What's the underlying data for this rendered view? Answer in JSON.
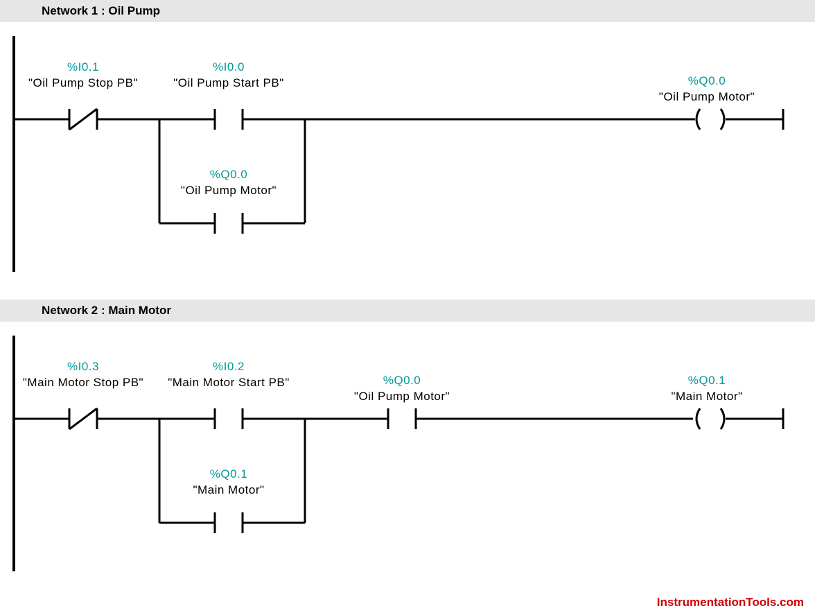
{
  "networks": [
    {
      "title": "Network 1 : Oil Pump",
      "elements": {
        "nc": {
          "addr": "%I0.1",
          "name": "\"Oil Pump Stop PB\""
        },
        "no": {
          "addr": "%I0.0",
          "name": "\"Oil Pump Start PB\""
        },
        "latch": {
          "addr": "%Q0.0",
          "name": "\"Oil Pump Motor\""
        },
        "coil": {
          "addr": "%Q0.0",
          "name": "\"Oil Pump Motor\""
        }
      }
    },
    {
      "title": "Network 2 : Main Motor",
      "elements": {
        "nc": {
          "addr": "%I0.3",
          "name": "\"Main Motor Stop PB\""
        },
        "no": {
          "addr": "%I0.2",
          "name": "\"Main Motor Start PB\""
        },
        "cond": {
          "addr": "%Q0.0",
          "name": "\"Oil Pump Motor\""
        },
        "latch": {
          "addr": "%Q0.1",
          "name": "\"Main Motor\""
        },
        "coil": {
          "addr": "%Q0.1",
          "name": "\"Main Motor\""
        }
      }
    }
  ],
  "watermark": "InstrumentationTools.com"
}
